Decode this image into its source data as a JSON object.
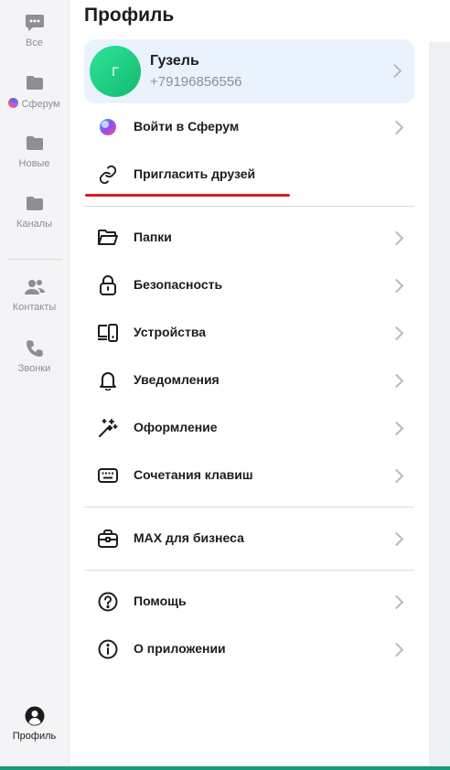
{
  "nav": {
    "items": [
      {
        "label": "Все",
        "icon": "chat-icon"
      },
      {
        "label": "Сферум",
        "icon": "folder-icon"
      },
      {
        "label": "Новые",
        "icon": "folder-icon"
      },
      {
        "label": "Каналы",
        "icon": "folder-icon"
      },
      {
        "label": "Контакты",
        "icon": "contacts-icon"
      },
      {
        "label": "Звонки",
        "icon": "phone-icon"
      },
      {
        "label": "Профиль",
        "icon": "profile-icon"
      }
    ],
    "active": "Профиль"
  },
  "page": {
    "title": "Профиль"
  },
  "profile": {
    "avatar_letter": "Г",
    "name": "Гузель",
    "phone": "+79196856556"
  },
  "menu": [
    {
      "label": "Войти в Сферум",
      "icon": "sferum-logo-icon",
      "chevron": true
    },
    {
      "label": "Пригласить друзей",
      "icon": "link-icon",
      "chevron": false
    },
    {
      "label": "Папки",
      "icon": "folder-open-icon",
      "chevron": true
    },
    {
      "label": "Безопасность",
      "icon": "lock-icon",
      "chevron": true
    },
    {
      "label": "Устройства",
      "icon": "devices-icon",
      "chevron": true
    },
    {
      "label": "Уведомления",
      "icon": "bell-icon",
      "chevron": true
    },
    {
      "label": "Оформление",
      "icon": "magic-wand-icon",
      "chevron": true
    },
    {
      "label": "Сочетания клавиш",
      "icon": "keyboard-icon",
      "chevron": true
    },
    {
      "label": "MAX для бизнеса",
      "icon": "briefcase-icon",
      "chevron": true
    },
    {
      "label": "Помощь",
      "icon": "help-icon",
      "chevron": true
    },
    {
      "label": "О приложении",
      "icon": "info-icon",
      "chevron": true
    }
  ],
  "colors": {
    "accent": "#eaf3fd",
    "underline": "#d91b1b",
    "avatar": "#19c97a",
    "bottom_bar": "#1a9978"
  }
}
